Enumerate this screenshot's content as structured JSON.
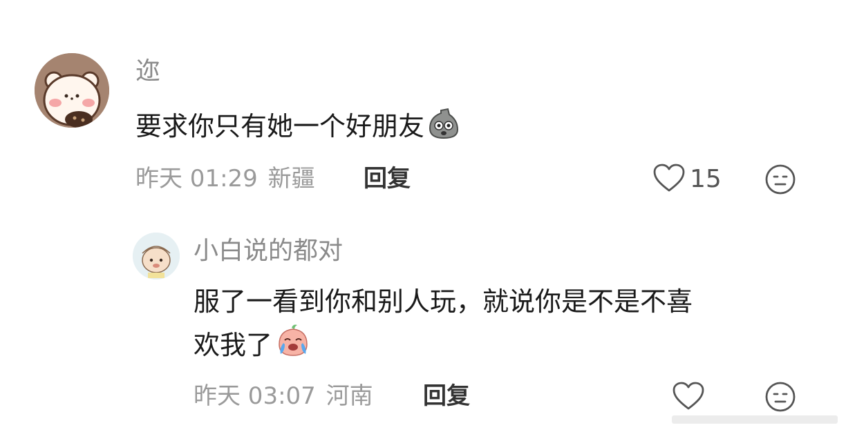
{
  "comment": {
    "username": "迩",
    "text": "要求你只有她一个好朋友",
    "emoji": "rock-surprised-emoji",
    "time": "昨天 01:29",
    "location": "新疆",
    "reply_label": "回复",
    "like_count": "15"
  },
  "reply": {
    "username": "小白说的都对",
    "text_line1": "服了一看到你和别人玩，就说你是不是不喜",
    "text_line2": "欢我了",
    "emoji": "crying-peach-emoji",
    "time": "昨天 03:07",
    "location": "河南",
    "reply_label": "回复"
  },
  "icons": {
    "like": "heart-icon",
    "dislike": "neutral-face-icon"
  },
  "colors": {
    "text": "#1a1a1a",
    "muted": "#9a9a9a",
    "username": "#8a8a8a"
  }
}
